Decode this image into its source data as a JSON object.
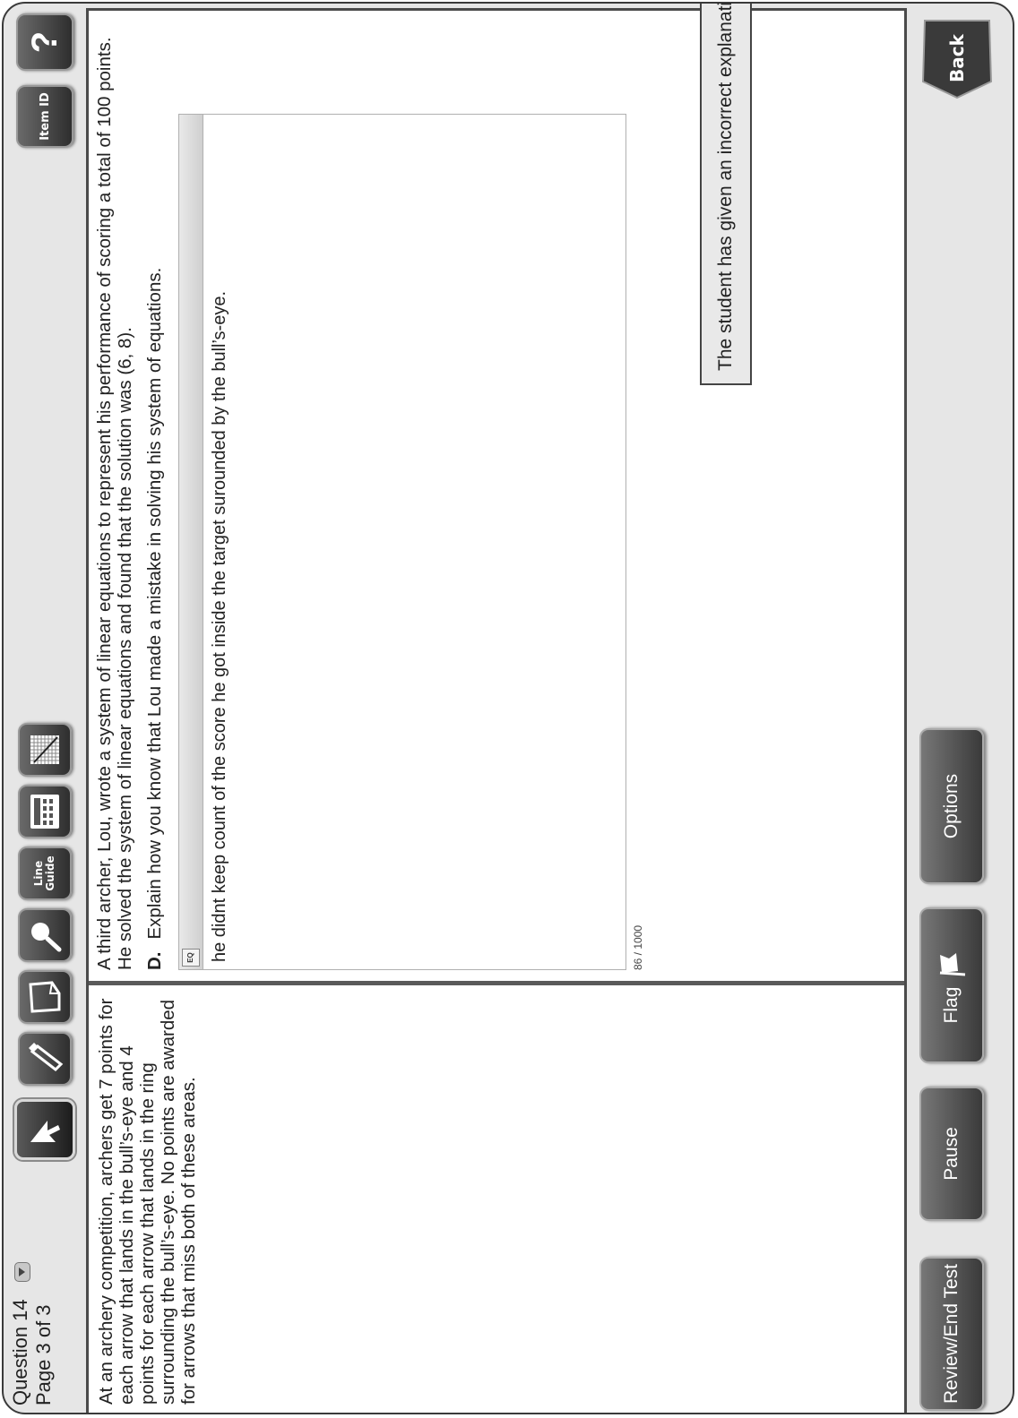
{
  "header": {
    "question_label": "Question 14",
    "page_label": "Page 3 of 3"
  },
  "toolbar": {
    "tools": [
      {
        "name": "pointer",
        "icon": "pointer-arrow-icon",
        "active": true
      },
      {
        "name": "highlighter",
        "icon": "highlighter-icon"
      },
      {
        "name": "sticky-note",
        "icon": "sticky-note-icon"
      },
      {
        "name": "magnifier",
        "icon": "magnifier-icon"
      },
      {
        "name": "line-guide",
        "icon": "line-guide-icon",
        "label": "Line Guide"
      },
      {
        "name": "calculator",
        "icon": "calculator-icon"
      },
      {
        "name": "graph-paper",
        "icon": "graph-paper-icon"
      }
    ],
    "item_id_label": "Item ID",
    "help_label": "?"
  },
  "passage": {
    "text": "At an archery competition, archers get 7 points for each arrow that lands in the bull’s-eye and 4 points for each arrow that lands in the ring surrounding the bull’s-eye. No points are awarded for arrows that miss both of these areas."
  },
  "question": {
    "stem": "A third archer, Lou, wrote a system of linear equations to represent his performance of scoring a total of 100 points. He solved the system of linear equations and found that the solution was (6, 8).",
    "part_letter": "D.",
    "part_text": "Explain how you know that Lou made a mistake in solving his system of equations.",
    "eq_button_label": "EQ",
    "answer_text": "he didnt keep count of the score he got inside the target surounded by the bull’s-eye.",
    "char_count": "86 / 1000",
    "score_note": "The student has given an incorrect explanation."
  },
  "nav": {
    "review_label": "Review/End Test",
    "pause_label": "Pause",
    "flag_label": "Flag",
    "options_label": "Options",
    "back_label": "Back"
  },
  "colors": {
    "frame": "#3a3a3a",
    "button_dark": "#3a3a3a",
    "panel_bg": "#ffffff",
    "chrome_bg": "#e6e6e6"
  }
}
